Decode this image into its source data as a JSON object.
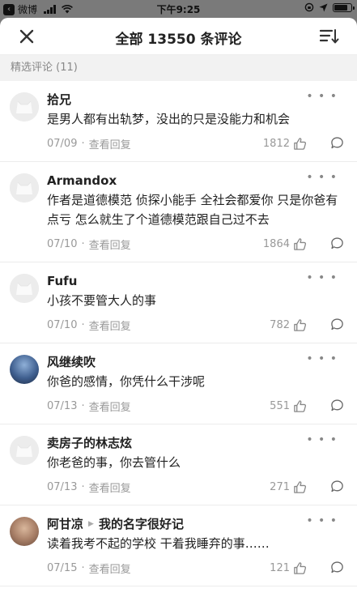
{
  "status_bar": {
    "back_label": "微博",
    "carrier_icon": "signal-icon",
    "time": "下午9:25"
  },
  "header": {
    "title": "全部 13550 条评论"
  },
  "section": {
    "label": "精选评论 (11)"
  },
  "comments": [
    {
      "user": "拾兄",
      "text": "是男人都有出轨梦，没出的只是没能力和机会",
      "date": "07/09",
      "view_replies": "查看回复",
      "likes": "1812",
      "avatar": "default"
    },
    {
      "user": "Armandox",
      "text": "作者是道德模范 侦探小能手 全社会都爱你 只是你爸有点亏 怎么就生了个道德模范跟自己过不去",
      "date": "07/10",
      "view_replies": "查看回复",
      "likes": "1864",
      "avatar": "default"
    },
    {
      "user": "Fufu",
      "text": "小孩不要管大人的事",
      "date": "07/10",
      "view_replies": "查看回复",
      "likes": "782",
      "avatar": "default"
    },
    {
      "user": "风继续吹",
      "text": "你爸的感情，你凭什么干涉呢",
      "date": "07/13",
      "view_replies": "查看回复",
      "likes": "551",
      "avatar": "photo-night"
    },
    {
      "user": "卖房子的林志炫",
      "text": "你老爸的事，你去管什么",
      "date": "07/13",
      "view_replies": "查看回复",
      "likes": "271",
      "avatar": "default"
    },
    {
      "user": "阿甘凉",
      "reply_to": "我的名字很好记",
      "text": "读着我考不起的学校 干着我睡弃的事……",
      "date": "07/15",
      "view_replies": "查看回复",
      "likes": "121",
      "avatar": "photo-girl"
    }
  ],
  "colors": {
    "overlay": "#7a7a7a",
    "section_bg": "#f2f2f2",
    "muted_text": "#999999"
  }
}
